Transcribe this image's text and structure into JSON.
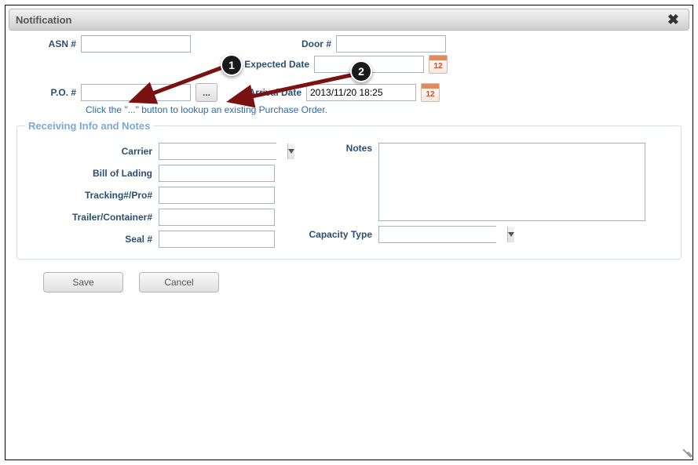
{
  "dialog": {
    "title": "Notification",
    "close_label": "✖"
  },
  "top": {
    "asn_label": "ASN #",
    "asn_value": "",
    "door_label": "Door #",
    "door_value": "",
    "expected_label": "Expected Date",
    "expected_value": "",
    "po_label": "P.O. #",
    "po_value": "",
    "lookup_label": "...",
    "arrival_label": "Arrival Date",
    "arrival_value": "2013/11/20 18:25",
    "hint": "Click the \"...\" button to lookup an existing Purchase Order.",
    "cal_glyph": "12"
  },
  "section": {
    "legend": "Receiving Info and Notes",
    "carrier_label": "Carrier",
    "carrier_value": "",
    "bol_label": "Bill of Lading",
    "bol_value": "",
    "tracking_label": "Tracking#/Pro#",
    "tracking_value": "",
    "trailer_label": "Trailer/Container#",
    "trailer_value": "",
    "seal_label": "Seal #",
    "seal_value": "",
    "notes_label": "Notes",
    "notes_value": "",
    "capacity_label": "Capacity Type",
    "capacity_value": ""
  },
  "buttons": {
    "save": "Save",
    "cancel": "Cancel"
  },
  "callouts": {
    "c1": "1",
    "c2": "2"
  }
}
